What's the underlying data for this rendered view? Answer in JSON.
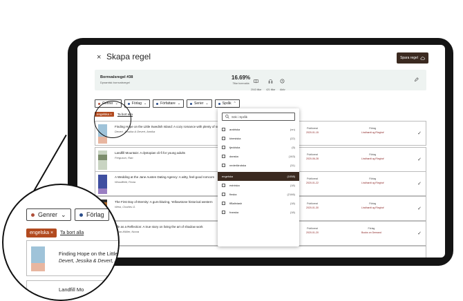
{
  "header": {
    "close": "×",
    "title": "Skapa regel",
    "save_label": "Spara regel"
  },
  "summary": {
    "rule_name": "Bornvalsregel #38",
    "rule_sub": "Dynamisk bornvalsregel",
    "percent": "16.69%",
    "percent_label": "Titlar bornvalda",
    "stats": [
      {
        "icon": "book-icon",
        "label": "2043 titlar"
      },
      {
        "icon": "headphones-icon",
        "label": "421 titlar"
      },
      {
        "icon": "clock-icon",
        "label": "Aktiv"
      }
    ]
  },
  "filters": [
    {
      "label": "Genrer",
      "dot": "#b0503a"
    },
    {
      "label": "Förlag",
      "dot": "#2a4d8a"
    },
    {
      "label": "Författare",
      "dot": "#2a4d8a"
    },
    {
      "label": "Serier",
      "dot": "#2a4d8a"
    },
    {
      "label": "Språk",
      "dot": "#2a4d8a"
    }
  ],
  "chips": {
    "active": "engelska",
    "clear": "Ta bort alla"
  },
  "rows": [
    {
      "title": "Finding Hope on the Little Swedish Island: A cozy romance with plenty of small-town",
      "author": "Devert, Jessika & Devert, Annika",
      "col1": "",
      "col1v": "",
      "col2": "Publicerat",
      "col2v": "2020-01-15",
      "col3": "Förlag",
      "col3v": "Lindhardt og Ringhof"
    },
    {
      "title": "Landfill Mountain: A dystopian cli-fi for young adults",
      "author": "Ferguson, Rab",
      "col1": "",
      "col1v": "",
      "col2": "Publicerat",
      "col2v": "2020-06-28",
      "col3": "Förlag",
      "col3v": "Lindhardt og Ringhof"
    },
    {
      "title": "A Wedding at the Jane Austen Dating Agency: A witty, feel-good romcom",
      "author": "Woodfield, Fiona",
      "col1": "",
      "col1v": "",
      "col2": "Publicerat",
      "col2v": "2020-01-22",
      "col3": "Förlag",
      "col3v": "Lindhardt og Ringhof"
    },
    {
      "title": "The First Day of Eternity: A gurs-blazing, Yellowstone historical western",
      "author": "West, Charles G.",
      "col1": "",
      "col1v": "",
      "col2": "Publicerat",
      "col2v": "2020-01-30",
      "col3": "Förlag",
      "col3v": "Lindhardt og Ringhof"
    },
    {
      "title": "Life as a Reflection: A true story on living the art of shadow work",
      "author": "Lahar-Müller, Noora",
      "col1": "ISBN",
      "col1v": "9789528699090",
      "col2": "Publicerat",
      "col2v": "2020-01-20",
      "col3": "Förlag",
      "col3v": "Books on Demand"
    }
  ],
  "dropdown": {
    "search_placeholder": "Sök i Språk",
    "options": [
      {
        "label": "arabiska",
        "count": "(nn)"
      },
      {
        "label": "kinesiska",
        "count": "(22)"
      },
      {
        "label": "tjeckiska",
        "count": "(5)"
      },
      {
        "label": "danska",
        "count": "(163)"
      },
      {
        "label": "nederländska",
        "count": "(31)"
      },
      {
        "label": "engelska",
        "count": "(1058)",
        "selected": true
      },
      {
        "label": "estniska",
        "count": "(18)"
      },
      {
        "label": "finska",
        "count": "(2166)"
      },
      {
        "label": "flBaliniash",
        "count": "(18)"
      },
      {
        "label": "franska",
        "count": "(18)"
      }
    ]
  },
  "zoom": {
    "filter1": "Genrer",
    "filter2": "Förlag",
    "chip": "engelska",
    "clear": "Ta bort alla",
    "row1_title": "Finding Hope on the Little Swedi",
    "row1_author": "Devert, Jessika & Devert, A",
    "row2_title": "Landfill Mo"
  }
}
